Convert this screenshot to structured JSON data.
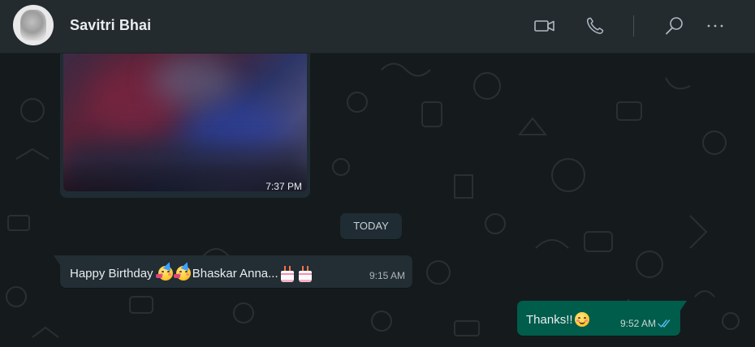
{
  "header": {
    "contact_name": "Savitri Bhai",
    "icons": [
      "video-call-icon",
      "voice-call-icon",
      "search-icon",
      "more-options-icon"
    ]
  },
  "messages": {
    "media": {
      "time": "7:37 PM"
    },
    "date_separator": "TODAY",
    "incoming": {
      "text_part1": "Happy Birthday ",
      "text_part2": "Bhaskar Anna...",
      "emojis": [
        "partying-face",
        "partying-face",
        "birthday-cake",
        "birthday-cake"
      ],
      "time": "9:15 AM"
    },
    "outgoing": {
      "text": "Thanks!!",
      "emoji": "smiling-face",
      "time": "9:52 AM",
      "status": "read"
    }
  },
  "colors": {
    "header_bg": "#242b2f",
    "chat_bg": "#151b1d",
    "incoming_bubble": "#222d34",
    "outgoing_bubble": "#005c4b",
    "read_ticks": "#53bdeb"
  }
}
